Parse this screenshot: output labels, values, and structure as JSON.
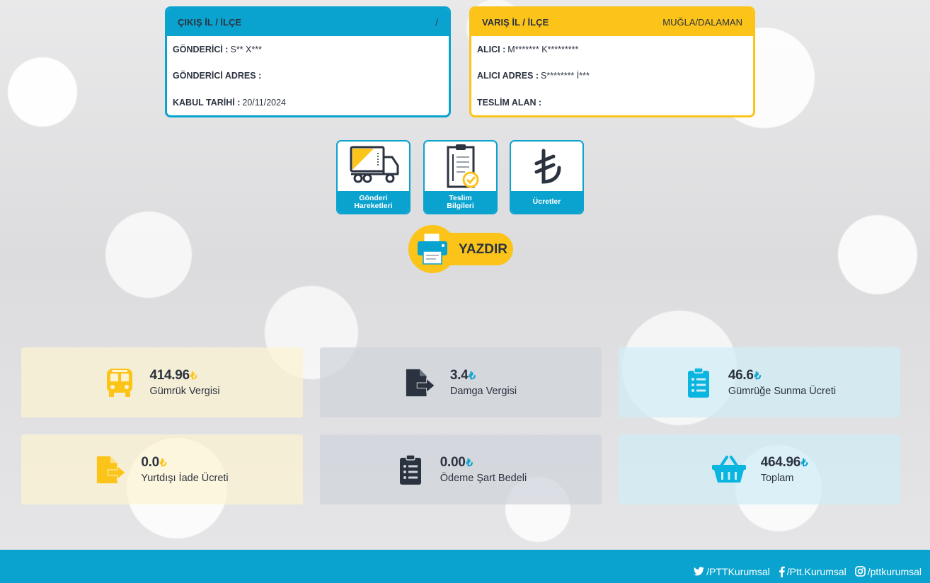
{
  "origin": {
    "header": "ÇIKIŞ İL / İLÇE",
    "header_value": "/",
    "sender_label": "GÖNDERİCİ :",
    "sender_value": "S** X***",
    "sender_address_label": "GÖNDERİCİ ADRES :",
    "sender_address_value": "",
    "accept_date_label": "KABUL TARİHİ :",
    "accept_date_value": "20/11/2024"
  },
  "destination": {
    "header": "VARIŞ İL / İLÇE",
    "header_value": "MUĞLA/DALAMAN",
    "receiver_label": "ALICI :",
    "receiver_value": "M******* K*********",
    "receiver_address_label": "ALICI ADRES :",
    "receiver_address_value": "S******** İ***",
    "delivered_to_label": "TESLİM ALAN :",
    "delivered_to_value": ""
  },
  "actions": {
    "movements_line1": "Gönderi",
    "movements_line2": "Hareketleri",
    "delivery_line1": "Teslim",
    "delivery_line2": "Bilgileri",
    "fees": "Ücretler",
    "print": "YAZDIR"
  },
  "fees": [
    {
      "value": "414.96",
      "currency": "₺",
      "label": "Gümrük Vergisi",
      "icon": "bus-icon"
    },
    {
      "value": "3.4",
      "currency": "₺",
      "label": "Damga Vergisi",
      "icon": "file-export-icon"
    },
    {
      "value": "46.6",
      "currency": "₺",
      "label": "Gümrüğe Sunma Ücreti",
      "icon": "clipboard-list-icon"
    },
    {
      "value": "0.0",
      "currency": "₺",
      "label": "Yurtdışı İade Ücreti",
      "icon": "file-export-icon"
    },
    {
      "value": "0.00",
      "currency": "₺",
      "label": "Ödeme Şart Bedeli",
      "icon": "clipboard-list-icon"
    },
    {
      "value": "464.96",
      "currency": "₺",
      "label": "Toplam",
      "icon": "basket-icon"
    }
  ],
  "footer": {
    "twitter": "/PTTKurumsal",
    "facebook": "/Ptt.Kurumsal",
    "instagram": "/pttkurumsal"
  },
  "colors": {
    "accent_blue": "#0aa3cf",
    "accent_yellow": "#fcc419",
    "text_dark": "#2c3340"
  }
}
